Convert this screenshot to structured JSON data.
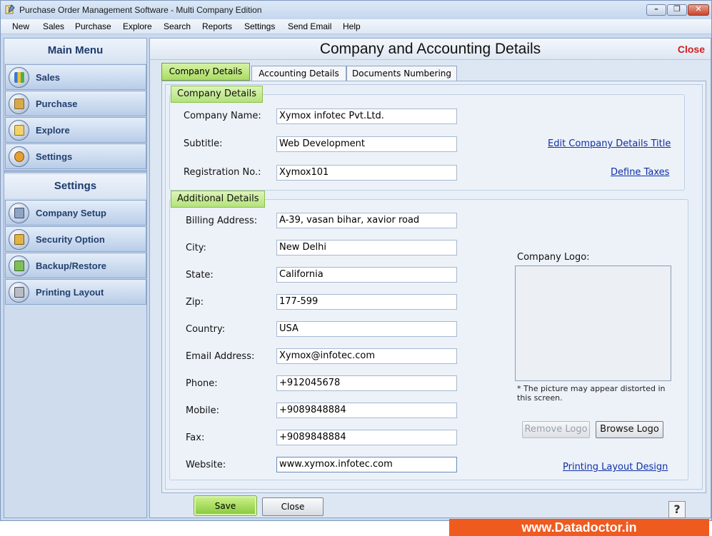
{
  "window": {
    "title": "Purchase Order Management Software - Multi Company Edition"
  },
  "menubar": {
    "items": [
      "New",
      "Sales",
      "Purchase",
      "Explore",
      "Search",
      "Reports",
      "Settings",
      "Send Email",
      "Help"
    ]
  },
  "sidebar": {
    "main_menu_title": "Main Menu",
    "main_items": [
      {
        "label": "Sales",
        "icon": "sales-chart-icon"
      },
      {
        "label": "Purchase",
        "icon": "purchase-box-icon"
      },
      {
        "label": "Explore",
        "icon": "explore-icon"
      },
      {
        "label": "Settings",
        "icon": "settings-icon"
      }
    ],
    "settings_title": "Settings",
    "settings_items": [
      {
        "label": "Company Setup",
        "icon": "company-setup-icon"
      },
      {
        "label": "Security Option",
        "icon": "lock-icon"
      },
      {
        "label": "Backup/Restore",
        "icon": "backup-icon"
      },
      {
        "label": "Printing Layout",
        "icon": "printer-icon"
      }
    ]
  },
  "main": {
    "title": "Company and Accounting Details",
    "close_label": "Close",
    "tabs": [
      {
        "label": "Company Details",
        "active": true
      },
      {
        "label": "Accounting Details",
        "active": false
      },
      {
        "label": "Documents Numbering",
        "active": false
      }
    ]
  },
  "company_details": {
    "group_title": "Company Details",
    "company_name_label": "Company Name:",
    "company_name_value": "Xymox infotec Pvt.Ltd.",
    "subtitle_label": "Subtitle:",
    "subtitle_value": "Web Development",
    "registration_label": "Registration No.:",
    "registration_value": "Xymox101",
    "edit_title_link": "Edit Company Details Title",
    "define_taxes_link": "Define Taxes"
  },
  "additional_details": {
    "group_title": "Additional Details",
    "fields": [
      {
        "label": "Billing Address:",
        "value": "A-39, vasan bihar, xavior road"
      },
      {
        "label": "City:",
        "value": "New Delhi"
      },
      {
        "label": "State:",
        "value": "California"
      },
      {
        "label": "Zip:",
        "value": "177-599"
      },
      {
        "label": "Country:",
        "value": "USA"
      },
      {
        "label": "Email Address:",
        "value": "Xymox@infotec.com"
      },
      {
        "label": "Phone:",
        "value": "+912045678"
      },
      {
        "label": "Mobile:",
        "value": "+9089848884"
      },
      {
        "label": "Fax:",
        "value": "+9089848884"
      },
      {
        "label": "Website:",
        "value": "www.xymox.infotec.com"
      }
    ],
    "logo_label": "Company Logo:",
    "logo_note": "* The picture may appear distorted in this screen.",
    "remove_logo_label": "Remove Logo",
    "browse_logo_label": "Browse Logo",
    "printing_layout_link": "Printing Layout Design"
  },
  "footer": {
    "save_label": "Save",
    "close_label": "Close",
    "help_label": "?"
  },
  "brand": {
    "text": "www.Datadoctor.in"
  },
  "colors": {
    "accent_green": "#a9dc62",
    "close_red": "#d11e1e",
    "brand_orange": "#ef5a1f",
    "link_blue": "#0e2fa6"
  }
}
